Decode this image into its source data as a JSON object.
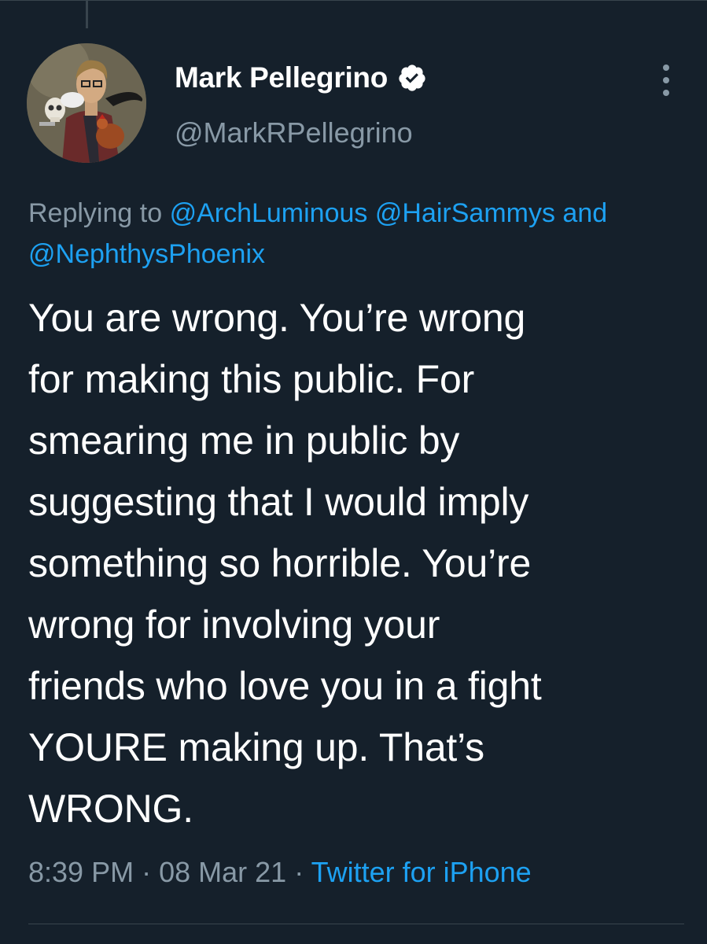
{
  "tweet": {
    "author": {
      "display_name": "Mark Pellegrino",
      "handle": "@MarkRPellegrino",
      "verified": true,
      "avatar_icon": "avatar-illustration"
    },
    "replying_prefix": "Replying to",
    "replying_to": [
      "@ArchLuminous",
      "@HairSammys"
    ],
    "replying_and": "and",
    "replying_last": "@NephthysPhoenix",
    "text_lines": [
      "You are wrong. You’re wrong",
      "for making this public. For",
      "smearing me in public by",
      "suggesting that I would imply",
      "something so horrible. You’re",
      "wrong for involving your",
      "friends who love you in a fight",
      "YOURE making up. That’s",
      "WRONG."
    ],
    "time": "8:39 PM",
    "separator": "·",
    "date": "08 Mar 21",
    "source": "Twitter for iPhone"
  },
  "icons": {
    "verified": "verified-badge-icon",
    "more": "more-options-icon"
  },
  "colors": {
    "background": "#15202b",
    "text": "#ffffff",
    "secondary": "#8899a6",
    "link": "#1da1f2",
    "divider": "#38444d"
  }
}
